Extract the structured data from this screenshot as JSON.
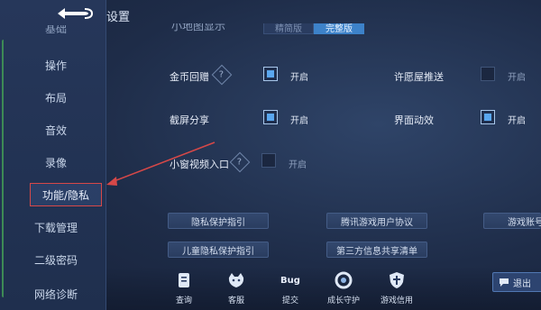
{
  "header": {
    "title": "设置",
    "back_icon": "back-arrow-icon"
  },
  "partial_row": {
    "label": "小地图显示",
    "options": [
      "精简版",
      "完整版"
    ],
    "selected": "完整版"
  },
  "sidebar": {
    "items": [
      {
        "label": "基础"
      },
      {
        "label": "操作"
      },
      {
        "label": "布局"
      },
      {
        "label": "音效"
      },
      {
        "label": "录像"
      },
      {
        "label": "功能/隐私",
        "active": true
      },
      {
        "label": "下载管理"
      },
      {
        "label": "二级密码"
      },
      {
        "label": "网络诊断"
      }
    ]
  },
  "settings": [
    {
      "label": "金币回赠",
      "state": "开启",
      "checked": true
    },
    {
      "label": "许愿屋推送",
      "state": "开启",
      "checked": false
    },
    {
      "label": "截屏分享",
      "state": "开启",
      "checked": true
    },
    {
      "label": "界面动效",
      "state": "开启",
      "checked": true
    },
    {
      "label": "小窗视频入口",
      "state": "开启",
      "checked": false
    }
  ],
  "links": [
    {
      "label": "隐私保护指引"
    },
    {
      "label": "腾讯游戏用户协议"
    },
    {
      "label": "游戏账号"
    },
    {
      "label": "儿童隐私保护指引"
    },
    {
      "label": "第三方信息共享清单"
    }
  ],
  "bottom": [
    {
      "label": "查询",
      "icon": "document-icon"
    },
    {
      "label": "客服",
      "icon": "customer-service-icon"
    },
    {
      "label": "提交",
      "icon": "bug-icon",
      "badge": "Bug"
    },
    {
      "label": "成长守护",
      "icon": "ring-icon"
    },
    {
      "label": "游戏信用",
      "icon": "shield-icon"
    }
  ],
  "logout": {
    "label": "退出"
  },
  "colors": {
    "accent": "#5aa7ef",
    "highlight": "#d64848",
    "background": "#1e2c48"
  }
}
